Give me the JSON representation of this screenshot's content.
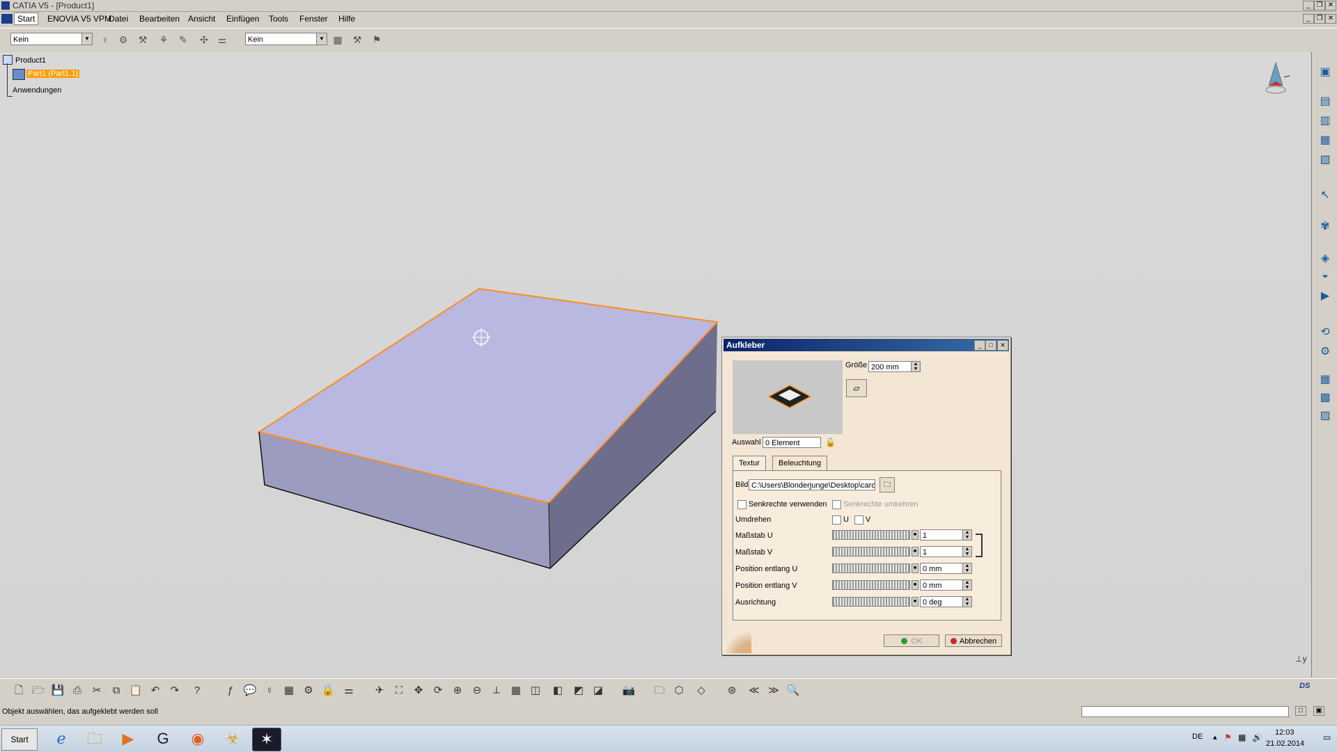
{
  "window": {
    "title": "CATIA V5 - [Product1]"
  },
  "menu": {
    "items": [
      "Start",
      "ENOVIA V5 VPM",
      "Datei",
      "Bearbeiten",
      "Ansicht",
      "Einfügen",
      "Tools",
      "Fenster",
      "Hilfe"
    ]
  },
  "toolbar": {
    "combo1": "Kein",
    "combo2": "Kein"
  },
  "tree": {
    "root": "Product1",
    "part": "Part1 (Part1.1)",
    "apps": "Anwendungen"
  },
  "status": {
    "message": "Objekt auswählen, das aufgeklebt werden soll"
  },
  "taskbar": {
    "start": "Start",
    "lang": "DE",
    "time": "12:03",
    "date": "21.02.2014"
  },
  "dialog": {
    "title": "Aufkleber",
    "size_label": "Größe",
    "size_value": "200 mm",
    "selection_label": "Auswahl",
    "selection_value": "0 Element",
    "tabs": [
      "Textur",
      "Beleuchtung"
    ],
    "image_label": "Bild",
    "image_path": "C:\\Users\\Blonderjunge\\Desktop\\caro.bmp",
    "use_normal": "Senkrechte verwenden",
    "invert_normal": "Senkrechte umkehren",
    "flip_label": "Umdrehen",
    "flip_u": "U",
    "flip_v": "V",
    "rows": [
      {
        "label": "Maßstab U",
        "value": "1"
      },
      {
        "label": "Maßstab V",
        "value": "1"
      },
      {
        "label": "Position entlang U",
        "value": "0 mm"
      },
      {
        "label": "Position entlang V",
        "value": "0 mm"
      },
      {
        "label": "Ausrichtung",
        "value": "0 deg"
      }
    ],
    "ok": "OK",
    "cancel": "Abbrechen"
  },
  "colors": {
    "part_top": "#b8b8e0",
    "part_side": "#9c9cc0",
    "part_front": "#6e6e8c",
    "edge_highlight": "#ff8c1a",
    "title_gradient": "#0a246a"
  }
}
